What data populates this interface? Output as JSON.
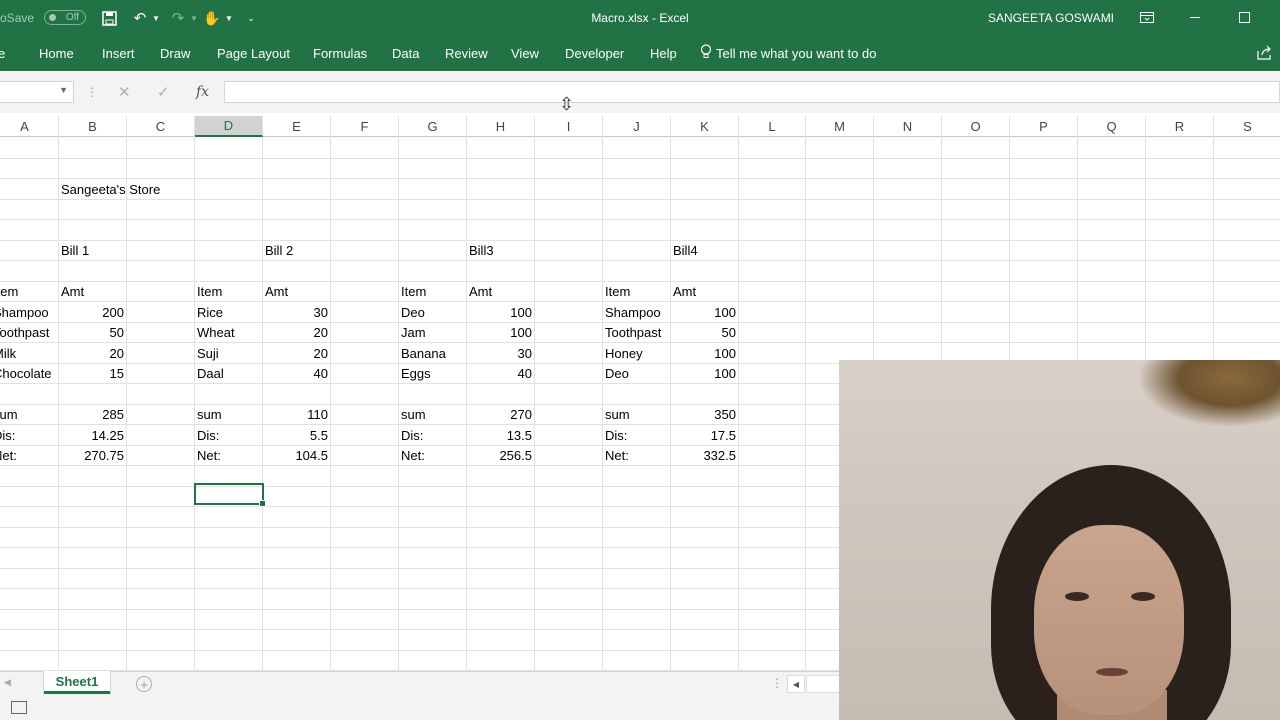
{
  "app": {
    "autosave_label": "AutoSave",
    "autosave_state": "Off",
    "document_title": "Macro.xlsx  -  Excel",
    "user_name": "SANGEETA GOSWAMI",
    "accent_color": "#217346"
  },
  "ribbon": {
    "tabs": [
      {
        "label": "e"
      },
      {
        "label": "Home"
      },
      {
        "label": "Insert"
      },
      {
        "label": "Draw"
      },
      {
        "label": "Page Layout"
      },
      {
        "label": "Formulas"
      },
      {
        "label": "Data"
      },
      {
        "label": "Review"
      },
      {
        "label": "View"
      },
      {
        "label": "Developer"
      },
      {
        "label": "Help"
      }
    ],
    "tell_me": "Tell me what you want to do"
  },
  "formula_bar": {
    "name_box": "",
    "formula": "",
    "fx_label": "fx"
  },
  "grid": {
    "columns": [
      "A",
      "B",
      "C",
      "D",
      "E",
      "F",
      "G",
      "H",
      "I",
      "J",
      "K",
      "L",
      "M",
      "N",
      "O",
      "P",
      "Q",
      "R",
      "S"
    ],
    "selected_column": "D",
    "cells": {
      "B3": "Sangeeta's Store",
      "B6": "Bill 1",
      "E6": "Bill 2",
      "H6": "Bill3",
      "K6": "Bill4",
      "A8": "Item",
      "B8": "Amt",
      "D8": "Item",
      "E8": "Amt",
      "G8": "Item",
      "H8": "Amt",
      "J8": "Item",
      "K8": "Amt",
      "A9": "Shampoo",
      "B9": "200",
      "D9": "Rice",
      "E9": "30",
      "G9": "Deo",
      "H9": "100",
      "J9": "Shampoo",
      "K9": "100",
      "A10": "Toothpast",
      "B10": "50",
      "D10": "Wheat",
      "E10": "20",
      "G10": "Jam",
      "H10": "100",
      "J10": "Toothpast",
      "K10": "50",
      "A11": "Milk",
      "B11": "20",
      "D11": "Suji",
      "E11": "20",
      "G11": "Banana",
      "H11": "30",
      "J11": "Honey",
      "K11": "100",
      "A12": "Chocolate",
      "B12": "15",
      "D12": "Daal",
      "E12": "40",
      "G12": "Eggs",
      "H12": "40",
      "J12": "Deo",
      "K12": "100",
      "A14": "sum",
      "B14": "285",
      "D14": "sum",
      "E14": "110",
      "G14": "sum",
      "H14": "270",
      "J14": "sum",
      "K14": "350",
      "A15": "Dis:",
      "B15": "14.25",
      "D15": "Dis:",
      "E15": "5.5",
      "G15": "Dis:",
      "H15": "13.5",
      "J15": "Dis:",
      "K15": "17.5",
      "A16": "Net:",
      "B16": "270.75",
      "D16": "Net:",
      "E16": "104.5",
      "G16": "Net:",
      "H16": "256.5",
      "J16": "Net:",
      "K16": "332.5"
    }
  },
  "sheets": {
    "tabs": [
      "Sheet1"
    ],
    "active": "Sheet1"
  }
}
